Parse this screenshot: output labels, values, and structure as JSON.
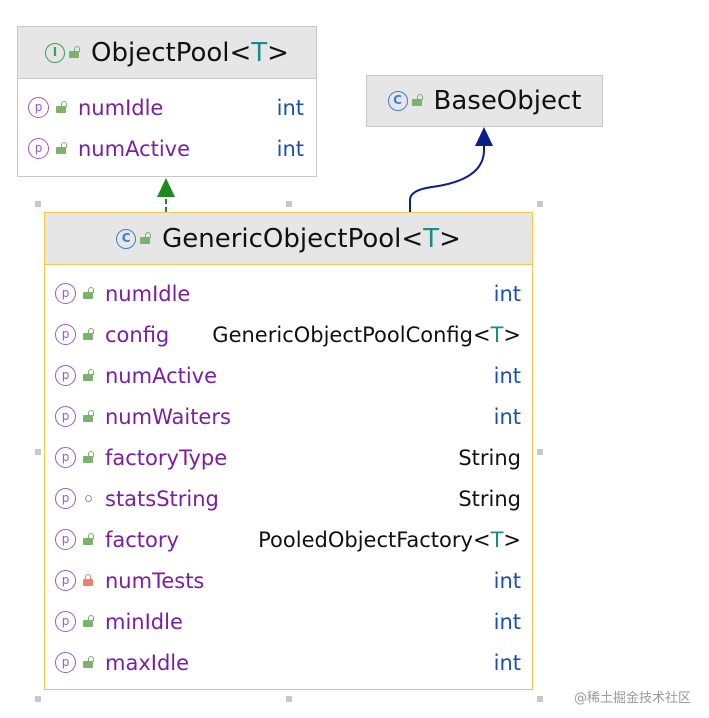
{
  "object_pool": {
    "name": "ObjectPool",
    "type_param": "T",
    "kind": "interface",
    "kind_glyph": "I",
    "fields": [
      {
        "name": "numIdle",
        "type": "int"
      },
      {
        "name": "numActive",
        "type": "int"
      }
    ]
  },
  "base_object": {
    "name": "BaseObject",
    "kind": "class",
    "kind_glyph": "C"
  },
  "generic_object_pool": {
    "name": "GenericObjectPool",
    "type_param": "T",
    "kind": "class",
    "kind_glyph": "C",
    "fields": [
      {
        "name": "numIdle",
        "type": "int",
        "access": "public"
      },
      {
        "name": "config",
        "type": "GenericObjectPoolConfig",
        "type_param": "T",
        "access": "public"
      },
      {
        "name": "numActive",
        "type": "int",
        "access": "public"
      },
      {
        "name": "numWaiters",
        "type": "int",
        "access": "public"
      },
      {
        "name": "factoryType",
        "type": "String",
        "access": "public"
      },
      {
        "name": "statsString",
        "type": "String",
        "access": "package"
      },
      {
        "name": "factory",
        "type": "PooledObjectFactory",
        "type_param": "T",
        "access": "public"
      },
      {
        "name": "numTests",
        "type": "int",
        "access": "private"
      },
      {
        "name": "minIdle",
        "type": "int",
        "access": "public"
      },
      {
        "name": "maxIdle",
        "type": "int",
        "access": "public"
      }
    ]
  },
  "field_glyph": "p",
  "relations": [
    {
      "from": "GenericObjectPool",
      "to": "ObjectPool",
      "kind": "implements",
      "color": "#1e8a1e"
    },
    {
      "from": "GenericObjectPool",
      "to": "BaseObject",
      "kind": "extends",
      "color": "#0b1f8a"
    }
  ],
  "colors": {
    "field_name": "#7a1fa2",
    "primitive_type": "#1a4fb5",
    "type_param": "#1b8a8a",
    "selection_border": "#f2c94c"
  },
  "watermark": "@稀土掘金技术社区"
}
